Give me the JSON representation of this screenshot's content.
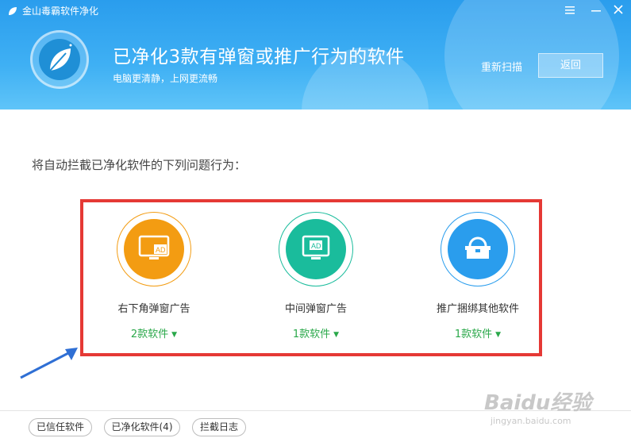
{
  "app": {
    "title": "金山毒霸软件净化",
    "window_controls": {
      "menu_icon": "menu-icon",
      "minimize_icon": "minimize-icon",
      "close_icon": "close-icon"
    }
  },
  "header": {
    "headline": "已净化3款有弹窗或推广行为的软件",
    "subline": "电脑更清静，上网更流畅",
    "rescan_label": "重新扫描",
    "back_label": "返回",
    "logo_icon": "leaf-icon"
  },
  "main": {
    "intro": "将自动拦截已净化软件的下列问题行为：",
    "items": [
      {
        "label": "右下角弹窗广告",
        "count": "2款软件",
        "icon": "ad-monitor-icon",
        "color": "#f39c12"
      },
      {
        "label": "中间弹窗广告",
        "count": "1款软件",
        "icon": "ad-screen-icon",
        "color": "#1abc9c"
      },
      {
        "label": "推广捆绑其他软件",
        "count": "1款软件",
        "icon": "bundle-box-icon",
        "color": "#2a9ded"
      }
    ]
  },
  "footer": {
    "buttons": [
      "已信任软件",
      "已净化软件(4)",
      "拦截日志"
    ]
  },
  "watermark": {
    "line1": "Baidu经验",
    "line2": "jingyan.baidu.com"
  },
  "colors": {
    "header": "#3aa9f0",
    "highlight": "#e53935",
    "count_text": "#2aa84a"
  }
}
